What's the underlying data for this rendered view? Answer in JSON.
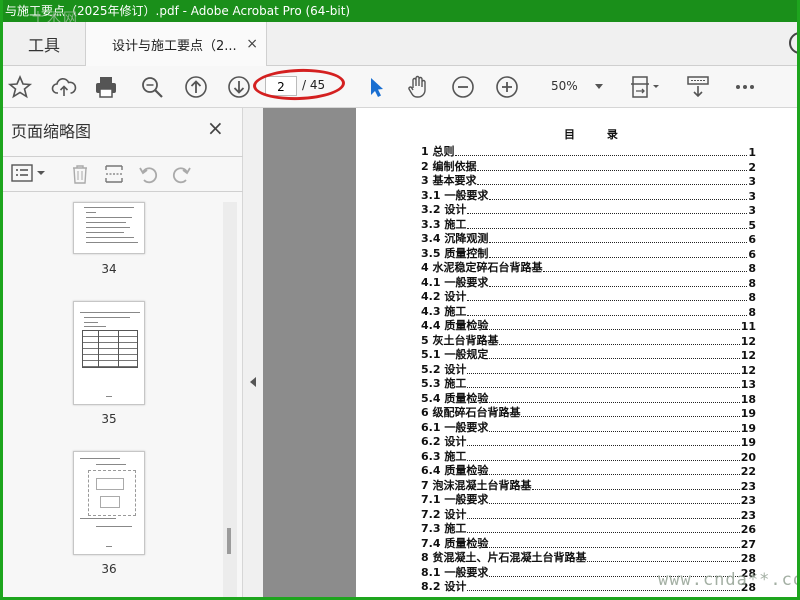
{
  "window": {
    "title": "与施工要点（2025年修订）.pdf - Adobe Acrobat Pro (64-bit)",
    "watermark_top": "土木网"
  },
  "tabs": {
    "tools_label": "工具",
    "doc_tab_label": "设计与施工要点（2...",
    "close_glyph": "×"
  },
  "toolbar": {
    "icons": [
      "bookmark-star-icon",
      "cloud-upload-icon",
      "print-icon",
      "zoom-search-icon",
      "page-up-icon",
      "page-down-icon",
      "select-arrow-icon",
      "hand-tool-icon",
      "zoom-out-icon",
      "zoom-in-icon",
      "fit-page-icon",
      "scroll-mode-icon",
      "more-icon"
    ],
    "current_page": "2",
    "total_pages": "/ 45",
    "zoom": "50%"
  },
  "sidebar": {
    "title": "页面缩略图",
    "close_glyph": "×",
    "thumbnails": [
      {
        "label": "34"
      },
      {
        "label": "35"
      },
      {
        "label": "36"
      }
    ]
  },
  "document": {
    "toc_title": "目 录",
    "entries": [
      {
        "label": "1 总则",
        "page": "1"
      },
      {
        "label": "2 编制依据",
        "page": "2"
      },
      {
        "label": "3 基本要求",
        "page": "3"
      },
      {
        "label": "3.1 一般要求",
        "page": "3"
      },
      {
        "label": "3.2 设计",
        "page": "3"
      },
      {
        "label": "3.3 施工",
        "page": "5"
      },
      {
        "label": "3.4 沉降观测",
        "page": "6"
      },
      {
        "label": "3.5 质量控制",
        "page": "6"
      },
      {
        "label": "4 水泥稳定碎石台背路基",
        "page": "8"
      },
      {
        "label": "4.1 一般要求",
        "page": "8"
      },
      {
        "label": "4.2 设计",
        "page": "8"
      },
      {
        "label": "4.3 施工",
        "page": "8"
      },
      {
        "label": "4.4 质量检验",
        "page": "11"
      },
      {
        "label": "5 灰土台背路基",
        "page": "12"
      },
      {
        "label": "5.1 一般规定",
        "page": "12"
      },
      {
        "label": "5.2 设计",
        "page": "12"
      },
      {
        "label": "5.3 施工",
        "page": "13"
      },
      {
        "label": "5.4 质量检验",
        "page": "18"
      },
      {
        "label": "6 级配碎石台背路基",
        "page": "19"
      },
      {
        "label": "6.1 一般要求",
        "page": "19"
      },
      {
        "label": "6.2 设计",
        "page": "19"
      },
      {
        "label": "6.3 施工",
        "page": "20"
      },
      {
        "label": "6.4 质量检验",
        "page": "22"
      },
      {
        "label": "7 泡沫混凝土台背路基",
        "page": "23"
      },
      {
        "label": "7.1 一般要求",
        "page": "23"
      },
      {
        "label": "7.2 设计",
        "page": "23"
      },
      {
        "label": "7.3 施工",
        "page": "26"
      },
      {
        "label": "7.4 质量检验",
        "page": "27"
      },
      {
        "label": "8 贫混凝土、片石混凝土台背路基",
        "page": "28"
      },
      {
        "label": "8.1 一般要求",
        "page": "28"
      },
      {
        "label": "8.2 设计",
        "page": "28"
      }
    ]
  },
  "watermark_bottom": "www.cnda**.com",
  "colors": {
    "titlebar": "#1a8f1a",
    "frame": "#1ea51e",
    "annotation_red": "#d42020",
    "select_tool": "#1a6fd1"
  }
}
